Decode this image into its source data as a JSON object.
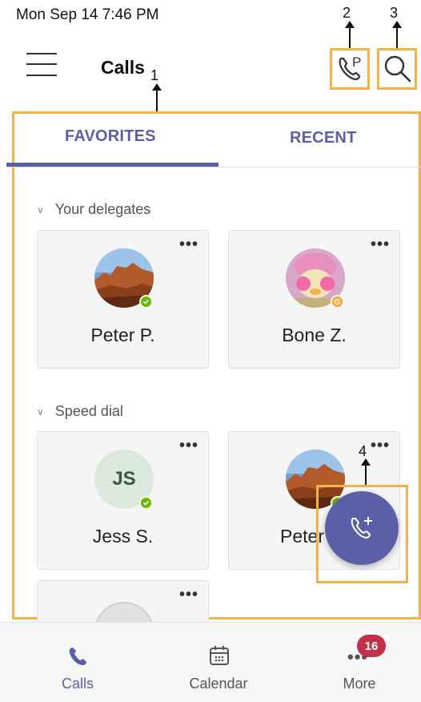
{
  "status_bar": {
    "time": "Mon Sep 14  7:46 PM"
  },
  "header": {
    "title": "Calls",
    "dialpad_icon": "phone-park-icon",
    "search_icon": "search-icon"
  },
  "annotations": [
    "1",
    "2",
    "3",
    "4"
  ],
  "tabs": [
    {
      "label": "FAVORITES",
      "active": true
    },
    {
      "label": "RECENT",
      "active": false
    }
  ],
  "sections": {
    "delegates": {
      "title": "Your delegates",
      "contacts": [
        {
          "name": "Peter P.",
          "presence": "available",
          "more": "•••"
        },
        {
          "name": "Bone Z.",
          "presence": "away",
          "more": "•••"
        }
      ]
    },
    "speed_dial": {
      "title": "Speed dial",
      "contacts": [
        {
          "name": "Jess S.",
          "initials": "JS",
          "presence": "available",
          "more": "•••"
        },
        {
          "name": "Peter",
          "presence": "available",
          "more": "•••"
        },
        {
          "name": "",
          "more": "•••"
        }
      ]
    }
  },
  "fab": {
    "icon": "add-call-icon"
  },
  "bottom_nav": {
    "items": [
      {
        "label": "Calls",
        "icon": "phone-icon",
        "active": true
      },
      {
        "label": "Calendar",
        "icon": "calendar-icon",
        "active": false
      },
      {
        "label": "More",
        "icon": "more-icon",
        "active": false
      }
    ],
    "badge": "16"
  },
  "colors": {
    "accent": "#5b5fa8",
    "highlight": "#f3b14a",
    "available": "#6bb700",
    "away": "#f8a530",
    "badge": "#c4314b"
  }
}
